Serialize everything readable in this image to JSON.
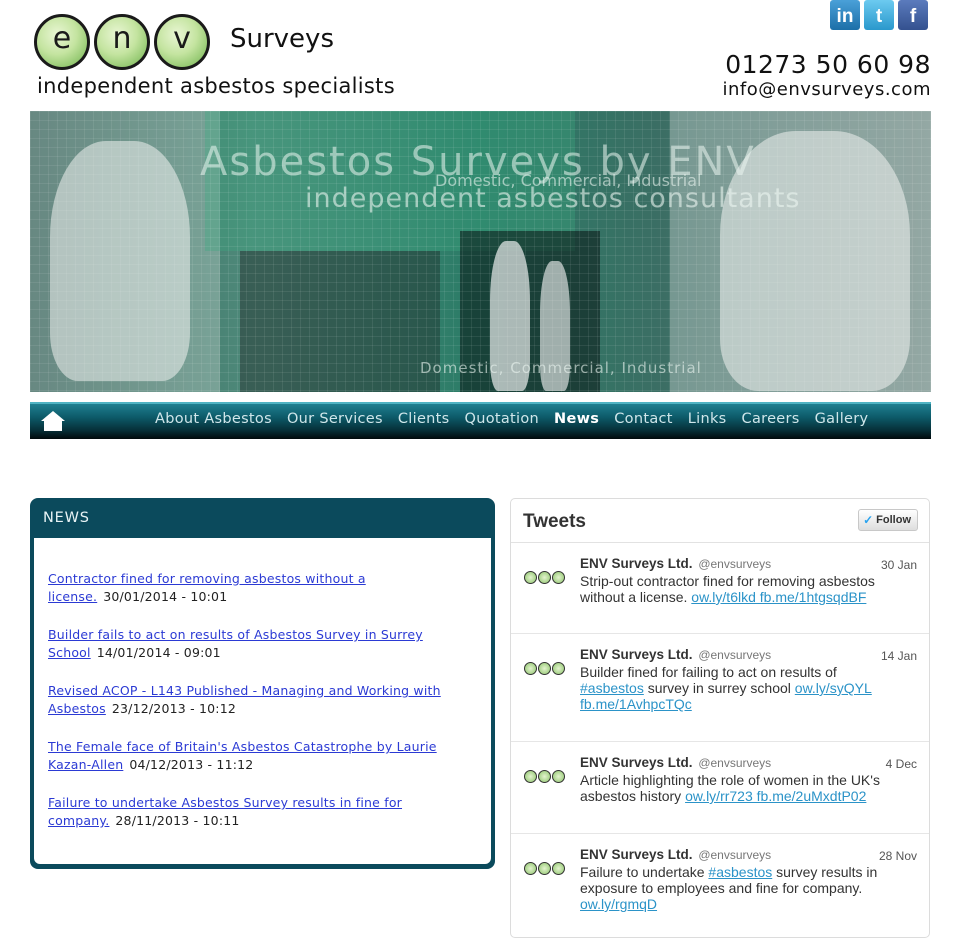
{
  "header": {
    "logo_letters": [
      "e",
      "n",
      "v"
    ],
    "logo_word": "Surveys",
    "tagline": "independent asbestos specialists",
    "phone": "01273 50 60 98",
    "email": "info@envsurveys.com",
    "social": [
      {
        "icon": "linkedin-icon",
        "glyph": "in"
      },
      {
        "icon": "twitter-icon",
        "glyph": "t"
      },
      {
        "icon": "facebook-icon",
        "glyph": "f"
      }
    ]
  },
  "banner": {
    "heading": "Asbestos Surveys by ENV",
    "subheading": "Domestic, Commercial, Industrial",
    "line2": "independent asbestos consultants",
    "footer_text": "Domestic, Commercial, Industrial"
  },
  "nav": {
    "items": [
      "About Asbestos",
      "Our Services",
      "Clients",
      "Quotation",
      "News",
      "Contact",
      "Links",
      "Careers",
      "Gallery"
    ],
    "active": "News"
  },
  "news": {
    "title": "NEWS",
    "items": [
      {
        "link": "Contractor fined for removing asbestos without a license.",
        "date": "30/01/2014 - 10:01"
      },
      {
        "link": "Builder fails to act on results of Asbestos Survey in Surrey School",
        "date": "14/01/2014 - 09:01"
      },
      {
        "link": "Revised ACOP - L143 Published - Managing and Working with Asbestos",
        "date": "23/12/2013 - 10:12"
      },
      {
        "link": "The Female face of Britain's Asbestos Catastrophe by Laurie Kazan-Allen",
        "date": "04/12/2013 - 11:12"
      },
      {
        "link": "Failure to undertake Asbestos Survey results in fine for company.",
        "date": "28/11/2013 - 10:11"
      }
    ]
  },
  "tweets": {
    "title": "Tweets",
    "follow_label": "Follow",
    "items": [
      {
        "name": "ENV Surveys Ltd.",
        "handle": "@envsurveys",
        "date": "30 Jan",
        "text": "Strip-out contractor fined for removing asbestos without a license.",
        "links": "ow.ly/t6lkd fb.me/1htgsqdBF"
      },
      {
        "name": "ENV Surveys Ltd.",
        "handle": "@envsurveys",
        "date": "14 Jan",
        "text_pre": "Builder fined for failing to act on results of",
        "hashtag": "#asbestos",
        "text_post": "survey in surrey school",
        "links": "ow.ly/syQYL fb.me/1AvhpcTQc"
      },
      {
        "name": "ENV Surveys Ltd.",
        "handle": "@envsurveys",
        "date": "4 Dec",
        "text": "Article highlighting the role of women in the UK's asbestos history",
        "links": "ow.ly/rr723 fb.me/2uMxdtP02"
      },
      {
        "name": "ENV Surveys Ltd.",
        "handle": "@envsurveys",
        "date": "28 Nov",
        "text_pre": "Failure to undertake",
        "hashtag": "#asbestos",
        "text_post": "survey results in exposure to employees and fine for company.",
        "links": "ow.ly/rgmqD"
      }
    ]
  }
}
